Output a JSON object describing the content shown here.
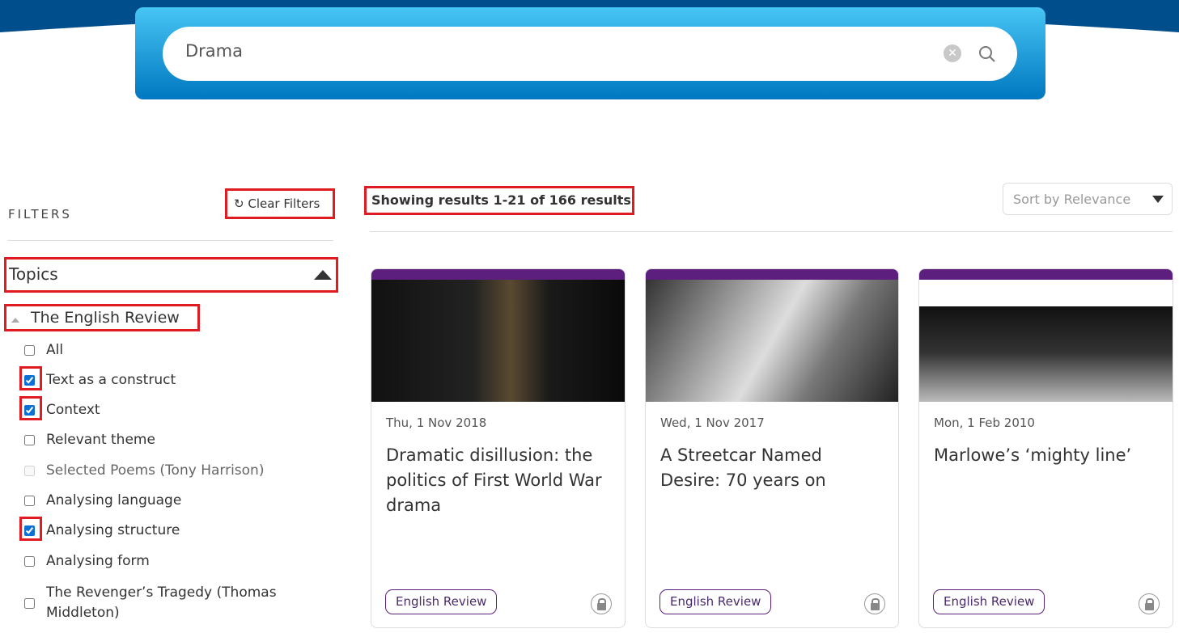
{
  "search": {
    "value": "Drama",
    "clear_icon": "clear-circle-icon",
    "search_icon": "search-icon"
  },
  "sidebar": {
    "title": "FILTERS",
    "clear_filters": "Clear Filters",
    "topics": "Topics",
    "group": "The English Review",
    "options": [
      {
        "label": "All",
        "checked": false
      },
      {
        "label": "Text as a construct",
        "checked": true
      },
      {
        "label": "Context",
        "checked": true
      },
      {
        "label": "Relevant theme",
        "checked": false
      },
      {
        "label": "Selected Poems (Tony Harrison)",
        "checked": false,
        "disabled": true
      },
      {
        "label": "Analysing language",
        "checked": false
      },
      {
        "label": "Analysing structure",
        "checked": true
      },
      {
        "label": "Analysing form",
        "checked": false
      },
      {
        "label": "The Revenger’s Tragedy (Thomas Middleton)",
        "checked": false
      }
    ]
  },
  "main": {
    "results": "Showing results 1-21 of 166 results",
    "sort": "Sort by Relevance",
    "cards": [
      {
        "date": "Thu, 1 Nov 2018",
        "title": "Dramatic disillusion: the politics of First World War drama",
        "tag": "English Review"
      },
      {
        "date": "Wed, 1 Nov 2017",
        "title": "A Streetcar Named Desire: 70 years on",
        "tag": "English Review"
      },
      {
        "date": "Mon, 1 Feb 2010",
        "title": "Marlowe’s ‘mighty line’",
        "tag": "English Review"
      }
    ]
  },
  "colors": {
    "header": "#004e8c",
    "accent": "#5c1f7d",
    "highlight": "#e11b22"
  }
}
